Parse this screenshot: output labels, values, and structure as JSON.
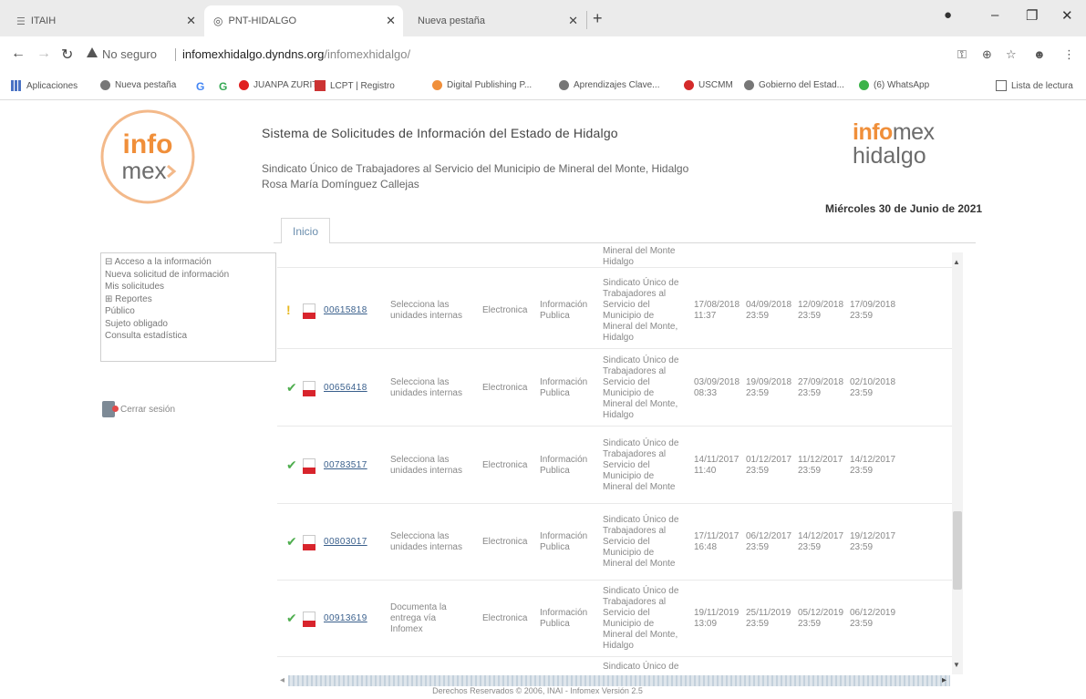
{
  "browser": {
    "tabs": [
      {
        "title": "ITAIH"
      },
      {
        "title": "PNT-HIDALGO"
      },
      {
        "title": "Nueva pestaña"
      }
    ],
    "url_security": "No seguro",
    "url_host": "infomexhidalgo.dyndns.org",
    "url_path": "/infomexhidalgo/",
    "bookmarks": [
      {
        "label": "Aplicaciones"
      },
      {
        "label": "Nueva pestaña"
      },
      {
        "label": "JUANPA ZURITA"
      },
      {
        "label": "LCPT | Registro"
      },
      {
        "label": "Digital Publishing P..."
      },
      {
        "label": "Aprendizajes Clave..."
      },
      {
        "label": "USCMM"
      },
      {
        "label": "Gobierno del Estad..."
      },
      {
        "label": "(6) WhatsApp"
      }
    ],
    "reading_list": "Lista de lectura",
    "colors": {
      "tabbar": "#ebebeb",
      "accent_orange": "#f08f3a"
    }
  },
  "header": {
    "logo_left_top": "info",
    "logo_left_bottom": "mex",
    "title": "Sistema de Solicitudes de Información del Estado de Hidalgo",
    "organization": "Sindicato Único de Trabajadores al Servicio del Municipio de Mineral del Monte, Hidalgo",
    "user": "Rosa María Domínguez Callejas",
    "logo_right_a": "info",
    "logo_right_b": "mex",
    "logo_right_c": "hidalgo",
    "date": "Miércoles 30 de Junio de 2021"
  },
  "tabs": {
    "home": "Inicio"
  },
  "menu": {
    "items": [
      "⊟ Acceso a la información",
      "Nueva solicitud de información",
      "Mis solicitudes",
      "⊞ Reportes",
      "Público",
      "Sujeto obligado",
      "Consulta estadística"
    ],
    "logout": "Cerrar sesión"
  },
  "grid": {
    "partial_top": [
      "Mineral del Monte",
      "Hidalgo"
    ],
    "partial_bottom": "Sindicato Único de",
    "rows": [
      {
        "status": "!",
        "folio": "00615818",
        "action": [
          "Selecciona las",
          "unidades internas"
        ],
        "mode": "Electronica",
        "type": [
          "Información",
          "Publica"
        ],
        "subject": [
          "Sindicato Único de",
          "Trabajadores al",
          "Servicio del",
          "Municipio de",
          "Mineral del Monte,",
          "Hidalgo"
        ],
        "d1": [
          "17/08/2018",
          "11:37"
        ],
        "d2": [
          "04/09/2018",
          "23:59"
        ],
        "d3": [
          "12/09/2018",
          "23:59"
        ],
        "d4": [
          "17/09/2018",
          "23:59"
        ]
      },
      {
        "status": "✔",
        "folio": "00656418",
        "action": [
          "Selecciona las",
          "unidades internas"
        ],
        "mode": "Electronica",
        "type": [
          "Información",
          "Publica"
        ],
        "subject": [
          "Sindicato Único de",
          "Trabajadores al",
          "Servicio del",
          "Municipio de",
          "Mineral del Monte,",
          "Hidalgo"
        ],
        "d1": [
          "03/09/2018",
          "08:33"
        ],
        "d2": [
          "19/09/2018",
          "23:59"
        ],
        "d3": [
          "27/09/2018",
          "23:59"
        ],
        "d4": [
          "02/10/2018",
          "23:59"
        ]
      },
      {
        "status": "✔",
        "folio": "00783517",
        "action": [
          "Selecciona las",
          "unidades internas"
        ],
        "mode": "Electronica",
        "type": [
          "Información",
          "Publica"
        ],
        "subject": [
          "Sindicato Único de",
          "Trabajadores al",
          "Servicio del",
          "Municipio de",
          "Mineral del Monte"
        ],
        "d1": [
          "14/11/2017",
          "11:40"
        ],
        "d2": [
          "01/12/2017",
          "23:59"
        ],
        "d3": [
          "11/12/2017",
          "23:59"
        ],
        "d4": [
          "14/12/2017",
          "23:59"
        ]
      },
      {
        "status": "✔",
        "folio": "00803017",
        "action": [
          "Selecciona las",
          "unidades internas"
        ],
        "mode": "Electronica",
        "type": [
          "Información",
          "Publica"
        ],
        "subject": [
          "Sindicato Único de",
          "Trabajadores al",
          "Servicio del",
          "Municipio de",
          "Mineral del Monte"
        ],
        "d1": [
          "17/11/2017",
          "16:48"
        ],
        "d2": [
          "06/12/2017",
          "23:59"
        ],
        "d3": [
          "14/12/2017",
          "23:59"
        ],
        "d4": [
          "19/12/2017",
          "23:59"
        ]
      },
      {
        "status": "✔",
        "folio": "00913619",
        "action": [
          "Documenta la",
          "entrega vía",
          "Infomex"
        ],
        "mode": "Electronica",
        "type": [
          "Información",
          "Publica"
        ],
        "subject": [
          "Sindicato Único de",
          "Trabajadores al",
          "Servicio del",
          "Municipio de",
          "Mineral del Monte,",
          "Hidalgo"
        ],
        "d1": [
          "19/11/2019",
          "13:09"
        ],
        "d2": [
          "25/11/2019",
          "23:59"
        ],
        "d3": [
          "05/12/2019",
          "23:59"
        ],
        "d4": [
          "06/12/2019",
          "23:59"
        ]
      }
    ]
  },
  "footer": "Derechos Reservados © 2006, INAI - Infomex Versión 2.5"
}
